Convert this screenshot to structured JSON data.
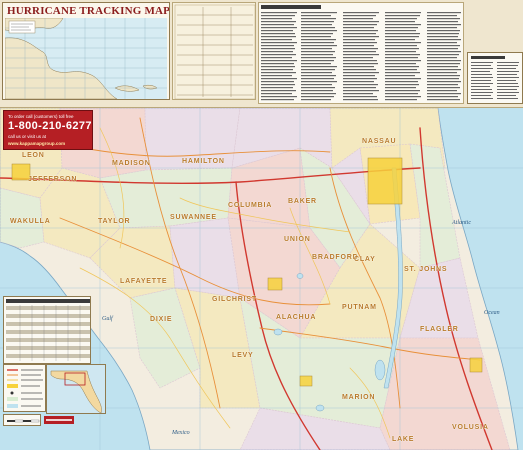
{
  "hurricane_tracking": {
    "title": "HURRICANE TRACKING MAP"
  },
  "contact": {
    "line1": "To order call (customers) toll free",
    "phone": "1-800-210-6277",
    "line2": "call us or visit us at",
    "website": "www.kappamapgroup.com"
  },
  "counties": [
    {
      "name": "NASSAU"
    },
    {
      "name": "MADISON"
    },
    {
      "name": "HAMILTON"
    },
    {
      "name": "LEON"
    },
    {
      "name": "JEFFERSON"
    },
    {
      "name": "WAKULLA"
    },
    {
      "name": "TAYLOR"
    },
    {
      "name": "SUWANNEE"
    },
    {
      "name": "COLUMBIA"
    },
    {
      "name": "BAKER"
    },
    {
      "name": "UNION"
    },
    {
      "name": "BRADFORD"
    },
    {
      "name": "CLAY"
    },
    {
      "name": "ST. JOHNS"
    },
    {
      "name": "LAFAYETTE"
    },
    {
      "name": "GILCHRIST"
    },
    {
      "name": "ALACHUA"
    },
    {
      "name": "PUTNAM"
    },
    {
      "name": "FLAGLER"
    },
    {
      "name": "DIXIE"
    },
    {
      "name": "LEVY"
    },
    {
      "name": "MARION"
    },
    {
      "name": "VOLUSIA"
    },
    {
      "name": "LAKE"
    }
  ],
  "water_labels": {
    "gulf": "Gulf",
    "atlantic": "Atlantic",
    "ocean": "Ocean",
    "mexico": "Mexico"
  },
  "colors": {
    "water": "#bfe2ef",
    "land": "#f3ede0",
    "county_label": "#b87a2a",
    "accent_red": "#b51f24",
    "title_red": "#8b1d1d"
  }
}
